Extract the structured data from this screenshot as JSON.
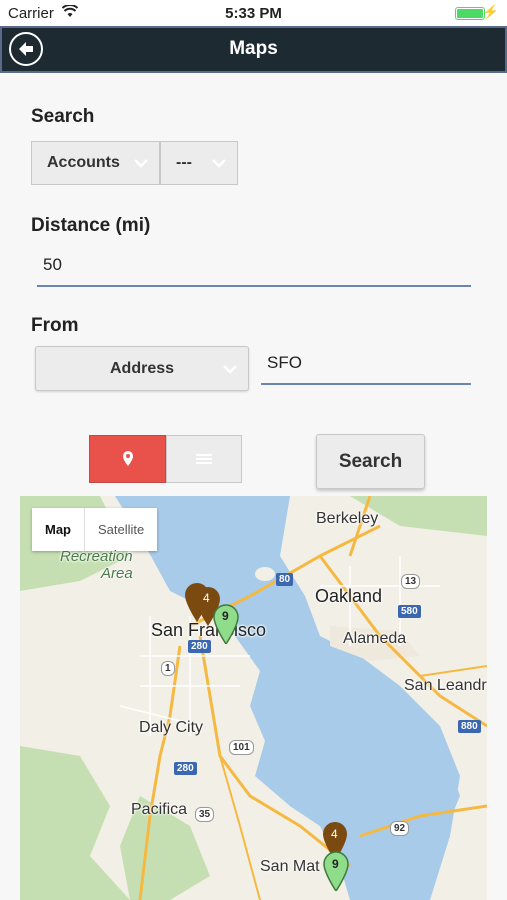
{
  "status_bar": {
    "carrier": "Carrier",
    "time": "5:33 PM"
  },
  "header": {
    "title": "Maps"
  },
  "search": {
    "label": "Search",
    "type_select": "Accounts",
    "filter_select": "---"
  },
  "distance": {
    "label": "Distance (mi)",
    "value": "50"
  },
  "from": {
    "label": "From",
    "mode_select": "Address",
    "value": "SFO"
  },
  "actions": {
    "search_label": "Search"
  },
  "map": {
    "type_map": "Map",
    "type_satellite": "Satellite",
    "places": {
      "berkeley": "Berkeley",
      "oakland": "Oakland",
      "san_francisco": "San Francisco",
      "alameda": "Alameda",
      "san_leandro": "San Leandr",
      "daly_city": "Daly City",
      "pacifica": "Pacifica",
      "san_mateo": "San Mat",
      "recreation": "Recreation",
      "area": "Area"
    },
    "shields": {
      "i80": "80",
      "r13": "13",
      "i580": "580",
      "r1": "1",
      "i280": "280",
      "r101": "101",
      "i280b": "280",
      "i880": "880",
      "r35": "35",
      "r92": "92"
    },
    "markers": {
      "sf_cluster_brown": "4",
      "sf_cluster_green": "9",
      "sm_cluster_brown": "4",
      "sm_cluster_green": "9"
    }
  },
  "colors": {
    "accent": "#e9524b",
    "nav": "#1e2a32",
    "marker_brown": "#7a4a10",
    "marker_green": "#8fdc8a"
  }
}
